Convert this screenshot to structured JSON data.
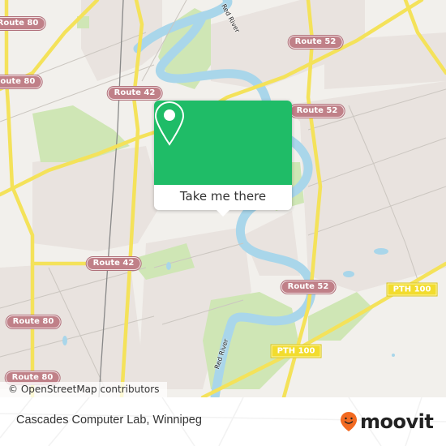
{
  "map": {
    "route_labels": [
      {
        "id": "route-80-a",
        "text": "Route 80"
      },
      {
        "id": "route-80-b",
        "text": "Route 80"
      },
      {
        "id": "route-42-a",
        "text": "Route 42"
      },
      {
        "id": "route-52-a",
        "text": "Route 52"
      },
      {
        "id": "route-52-b",
        "text": "Route 52"
      },
      {
        "id": "route-42-b",
        "text": "Route 42"
      },
      {
        "id": "route-80-c",
        "text": "Route 80"
      },
      {
        "id": "route-80-d",
        "text": "Route 80"
      },
      {
        "id": "route-52-c",
        "text": "Route 52"
      }
    ],
    "pth_labels": [
      {
        "id": "pth-100-a",
        "text": "PTH 100"
      },
      {
        "id": "pth-100-b",
        "text": "PTH 100"
      }
    ],
    "river_labels": [
      {
        "id": "red-river-north",
        "text": "Red River"
      },
      {
        "id": "red-river-south",
        "text": "Red River"
      }
    ],
    "attribution": "© OpenStreetMap contributors",
    "colors": {
      "land": "#f2f0ec",
      "residential": "#e8e2de",
      "park": "#c8e3a8",
      "water": "#a9d6ea",
      "major_road": "#f4e25a",
      "minor_road": "#c9c4bf",
      "route_shield": "#c08088",
      "pth_shield": "#f2dc2e"
    }
  },
  "popup": {
    "icon": "map-pin-icon",
    "button_label": "Take me there",
    "color": "#1fbc67"
  },
  "footer": {
    "place_name": "Cascades Computer Lab, Winnipeg",
    "brand": "moovit",
    "brand_icon": "moovit-smiley-pin-icon",
    "brand_color": "#f26a21"
  }
}
